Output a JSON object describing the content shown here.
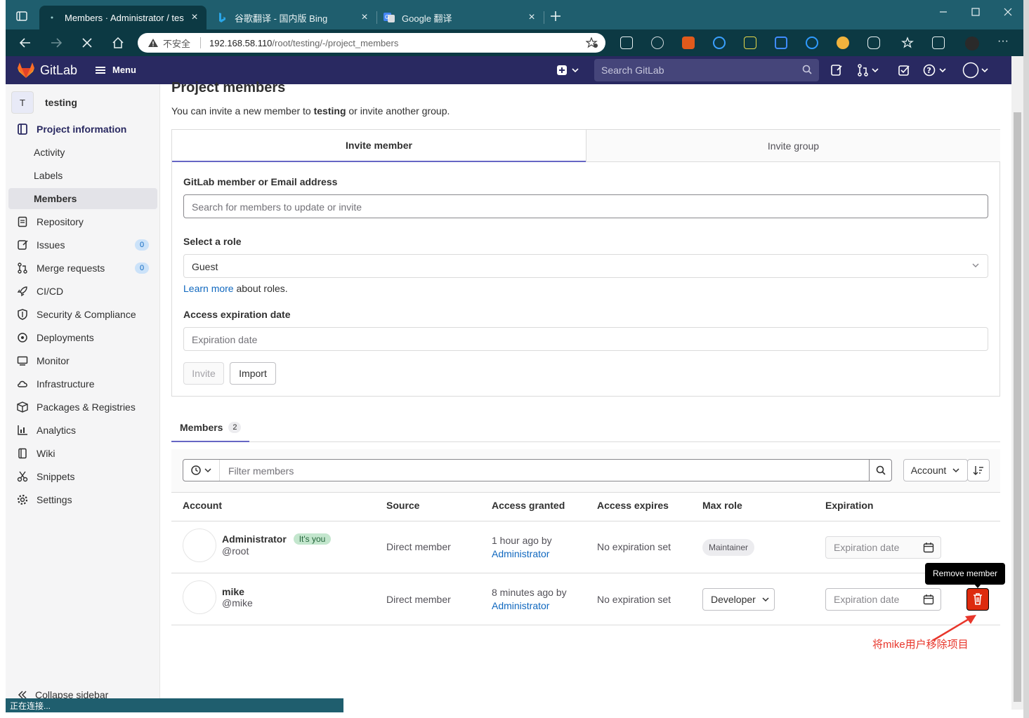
{
  "browser": {
    "tabs": [
      {
        "title": "Members · Administrator / testin",
        "active": true
      },
      {
        "title": "谷歌翻译 - 国内版 Bing",
        "active": false
      },
      {
        "title": "Google 翻译",
        "active": false
      }
    ],
    "address": {
      "security_label": "不安全",
      "host": "192.168.58.110",
      "path": "/root/testing/-/project_members"
    },
    "status_text": "正在连接..."
  },
  "header": {
    "brand": "GitLab",
    "menu_label": "Menu",
    "search_placeholder": "Search GitLab"
  },
  "sidebar": {
    "project_initial": "T",
    "project_name": "testing",
    "items": [
      {
        "label": "Project information",
        "icon": "info-icon"
      },
      {
        "label": "Activity"
      },
      {
        "label": "Labels"
      },
      {
        "label": "Members"
      },
      {
        "label": "Repository",
        "icon": "doc-icon"
      },
      {
        "label": "Issues",
        "icon": "issues-icon",
        "count": "0"
      },
      {
        "label": "Merge requests",
        "icon": "merge-icon",
        "count": "0"
      },
      {
        "label": "CI/CD",
        "icon": "rocket-icon"
      },
      {
        "label": "Security & Compliance",
        "icon": "shield-icon"
      },
      {
        "label": "Deployments",
        "icon": "deploy-icon"
      },
      {
        "label": "Monitor",
        "icon": "monitor-icon"
      },
      {
        "label": "Infrastructure",
        "icon": "cloud-icon"
      },
      {
        "label": "Packages & Registries",
        "icon": "package-icon"
      },
      {
        "label": "Analytics",
        "icon": "chart-icon"
      },
      {
        "label": "Wiki",
        "icon": "book-icon"
      },
      {
        "label": "Snippets",
        "icon": "scissors-icon"
      },
      {
        "label": "Settings",
        "icon": "gear-icon"
      }
    ],
    "collapse_label": "Collapse sidebar"
  },
  "page": {
    "title": "Project members",
    "intro_before": "You can invite a new member to",
    "intro_project": "testing",
    "intro_after": "or invite another group.",
    "tabs": {
      "invite_member": "Invite member",
      "invite_group": "Invite group"
    },
    "form": {
      "member_label": "GitLab member or Email address",
      "member_placeholder": "Search for members to update or invite",
      "role_label": "Select a role",
      "role_value": "Guest",
      "learn_more": "Learn more",
      "about_roles": "about roles.",
      "expiry_label": "Access expiration date",
      "expiry_placeholder": "Expiration date",
      "invite_button": "Invite",
      "import_button": "Import"
    },
    "members_tab": {
      "label": "Members",
      "count": "2"
    },
    "filter": {
      "placeholder": "Filter members",
      "sort_label": "Account"
    },
    "table": {
      "columns": [
        "Account",
        "Source",
        "Access granted",
        "Access expires",
        "Max role",
        "Expiration"
      ],
      "rows": [
        {
          "name": "Administrator",
          "badge": "It's you",
          "username": "@root",
          "source": "Direct member",
          "granted": "1 hour ago by",
          "granted_by": "Administrator",
          "expires": "No expiration set",
          "role": "Maintainer",
          "expiration_placeholder": "Expiration date"
        },
        {
          "name": "mike",
          "username": "@mike",
          "source": "Direct member",
          "granted": "8 minutes ago by",
          "granted_by": "Administrator",
          "expires": "No expiration set",
          "role": "Developer",
          "expiration_placeholder": "Expiration date"
        }
      ]
    },
    "tooltip": "Remove member",
    "annotation": "将mike用户移除项目"
  }
}
